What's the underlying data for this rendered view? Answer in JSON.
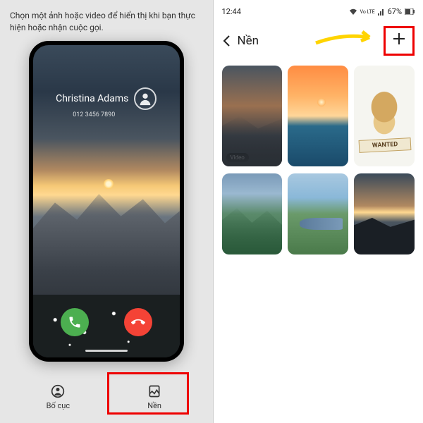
{
  "left": {
    "instruction": "Chọn một ảnh hoặc video để hiển thị khi bạn thực hiện hoặc nhận cuộc gọi.",
    "caller_name": "Christina Adams",
    "caller_number": "012 3456 7890",
    "tabs": [
      {
        "label": "Bố cục"
      },
      {
        "label": "Nền"
      }
    ]
  },
  "right": {
    "status_time": "12:44",
    "battery": "67%",
    "title": "Nền",
    "video_badge": "Video",
    "dog_sign": "WANTED"
  }
}
